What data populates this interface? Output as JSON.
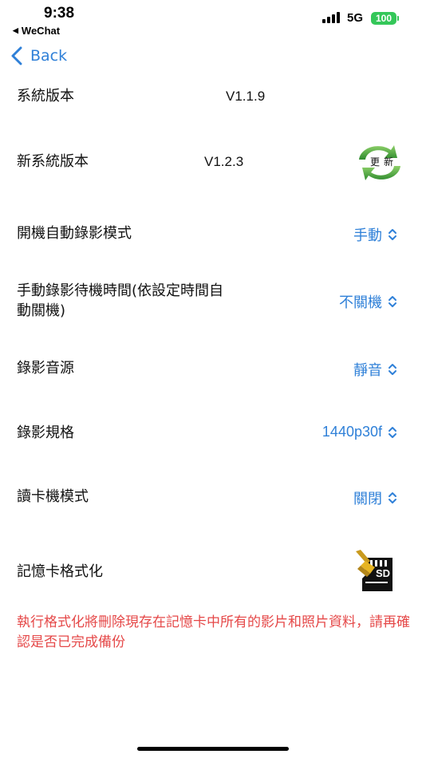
{
  "status_bar": {
    "time": "9:38",
    "back_app": "WeChat",
    "network": "5G",
    "battery": "100",
    "battery_color": "#34c759"
  },
  "nav": {
    "back_label": "Back",
    "accent_color": "#2f80d8"
  },
  "settings": {
    "system_version": {
      "label": "系統版本",
      "value": "V1.1.9"
    },
    "new_system_version": {
      "label": "新系統版本",
      "value": "V1.2.3",
      "icon": "update-icon",
      "icon_text_1": "更",
      "icon_text_2": "新"
    },
    "auto_record_mode": {
      "label": "開機自動錄影模式",
      "selected": "手動"
    },
    "standby_time": {
      "label_line1": "手動錄影待機時間(依設定時間自",
      "label_line2": "動關機)",
      "selected": "不關機"
    },
    "audio_source": {
      "label": "錄影音源",
      "selected": "靜音"
    },
    "record_spec": {
      "label": "錄影規格",
      "selected": "1440p30f"
    },
    "card_reader_mode": {
      "label": "讀卡機模式",
      "selected": "關閉"
    },
    "format_card": {
      "label": "記憶卡格式化",
      "icon": "sd-card-format-icon",
      "icon_text": "SD"
    }
  },
  "warning": {
    "text": "執行格式化將刪除現存在記憶卡中所有的影片和照片資料，請再確認是否已完成備份",
    "color": "#e54848"
  }
}
